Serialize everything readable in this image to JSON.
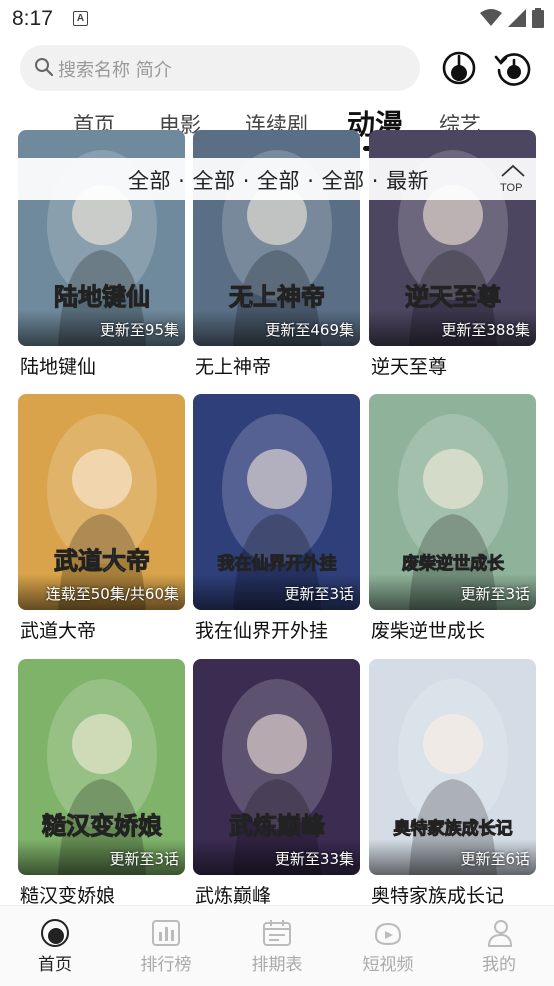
{
  "status": {
    "time": "8:17",
    "notif_letter": "A"
  },
  "search": {
    "placeholder": "搜索名称 简介"
  },
  "tabs": [
    {
      "label": "首页"
    },
    {
      "label": "电影"
    },
    {
      "label": "连续剧"
    },
    {
      "label": "动漫"
    },
    {
      "label": "综艺"
    }
  ],
  "active_tab": "动漫",
  "filter": {
    "text": "全部 · 全部 · 全部 · 全部 · 最新",
    "top_label": "TOP"
  },
  "items": [
    {
      "title": "陆地键仙",
      "episode": "更新至95集",
      "poster_text": "陆地键仙",
      "color": "#6f8a9c"
    },
    {
      "title": "无上神帝",
      "episode": "更新至469集",
      "poster_text": "无上神帝",
      "color": "#5a6f86"
    },
    {
      "title": "逆天至尊",
      "episode": "更新至388集",
      "poster_text": "逆天至尊",
      "color": "#4c4660"
    },
    {
      "title": "武道大帝",
      "episode": "连载至50集/共60集",
      "poster_text": "武道大帝",
      "color": "#d8a34a"
    },
    {
      "title": "我在仙界开外挂",
      "episode": "更新至3话",
      "poster_text": "我在仙界开外挂",
      "color": "#2f3f7a"
    },
    {
      "title": "废柴逆世成长",
      "episode": "更新至3话",
      "poster_text": "废柴逆世成长",
      "color": "#8fb39a"
    },
    {
      "title": "糙汉变娇娘",
      "episode": "更新至3话",
      "poster_text": "糙汉变娇娘",
      "color": "#7fb36a"
    },
    {
      "title": "武炼巅峰",
      "episode": "更新至33集",
      "poster_text": "武炼巅峰",
      "color": "#3b2c52"
    },
    {
      "title": "奥特家族成长记",
      "episode": "更新至6话",
      "poster_text": "奥特家族成长记",
      "color": "#d4dde6"
    }
  ],
  "bottom_nav": [
    {
      "label": "首页",
      "icon": "home-icon",
      "active": true
    },
    {
      "label": "排行榜",
      "icon": "ranking-icon",
      "active": false
    },
    {
      "label": "排期表",
      "icon": "schedule-icon",
      "active": false
    },
    {
      "label": "短视频",
      "icon": "short-video-icon",
      "active": false
    },
    {
      "label": "我的",
      "icon": "profile-icon",
      "active": false
    }
  ]
}
